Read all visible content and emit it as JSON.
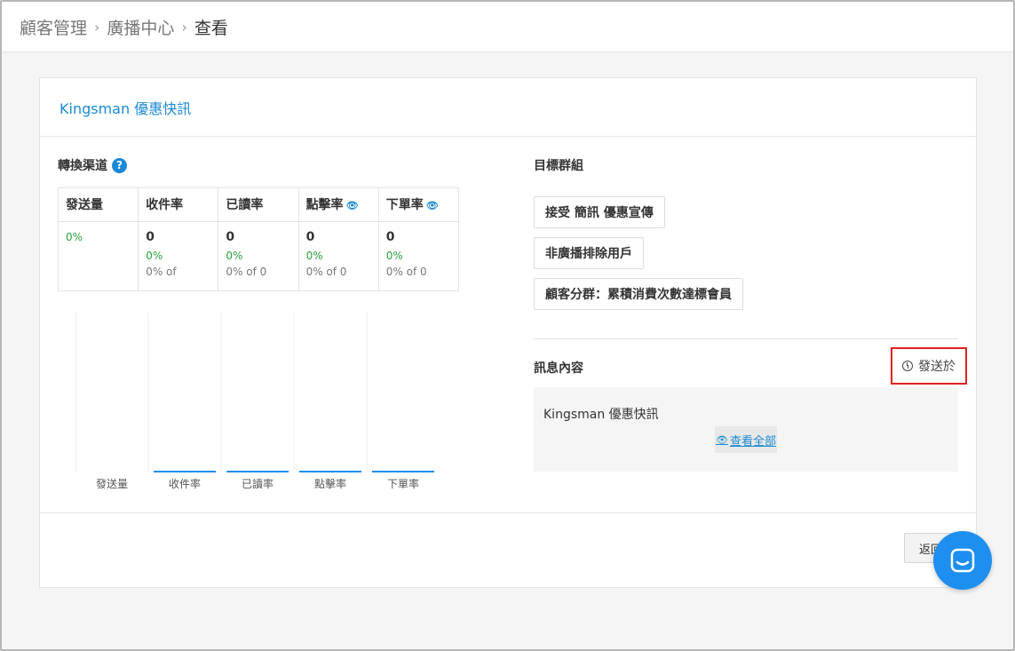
{
  "breadcrumb": [
    "顧客管理",
    "廣播中心",
    "查看"
  ],
  "card": {
    "title": "Kingsman 優惠快訊"
  },
  "conversion": {
    "label": "轉換渠道",
    "columns": [
      {
        "header": "發送量",
        "has_eye": false,
        "count": "",
        "pct": "0%",
        "of": ""
      },
      {
        "header": "收件率",
        "has_eye": false,
        "count": "0",
        "pct": "0%",
        "of": "0% of"
      },
      {
        "header": "已讀率",
        "has_eye": false,
        "count": "0",
        "pct": "0%",
        "of": "0% of 0"
      },
      {
        "header": "點擊率",
        "has_eye": true,
        "count": "0",
        "pct": "0%",
        "of": "0% of 0"
      },
      {
        "header": "下單率",
        "has_eye": true,
        "count": "0",
        "pct": "0%",
        "of": "0% of 0"
      }
    ]
  },
  "chart_data": {
    "type": "bar",
    "categories": [
      "發送量",
      "收件率",
      "已讀率",
      "點擊率",
      "下單率"
    ],
    "values": [
      0,
      0,
      0,
      0,
      0
    ],
    "title": "",
    "xlabel": "",
    "ylabel": ""
  },
  "target_group": {
    "label": "目標群組",
    "tags": [
      "接受 簡訊 優惠宣傳",
      "非廣播排除用戶",
      "顧客分群：累積消費次數達標會員"
    ]
  },
  "message": {
    "label": "訊息內容",
    "sent_label": "發送於",
    "text": "Kingsman 優惠快訊",
    "view_all": "查看全部"
  },
  "footer": {
    "back_label": "返回"
  },
  "colors": {
    "accent": "#1a8ad4",
    "positive": "#2aa33c",
    "highlight": "#e02020",
    "chat": "#1e8ff0"
  }
}
